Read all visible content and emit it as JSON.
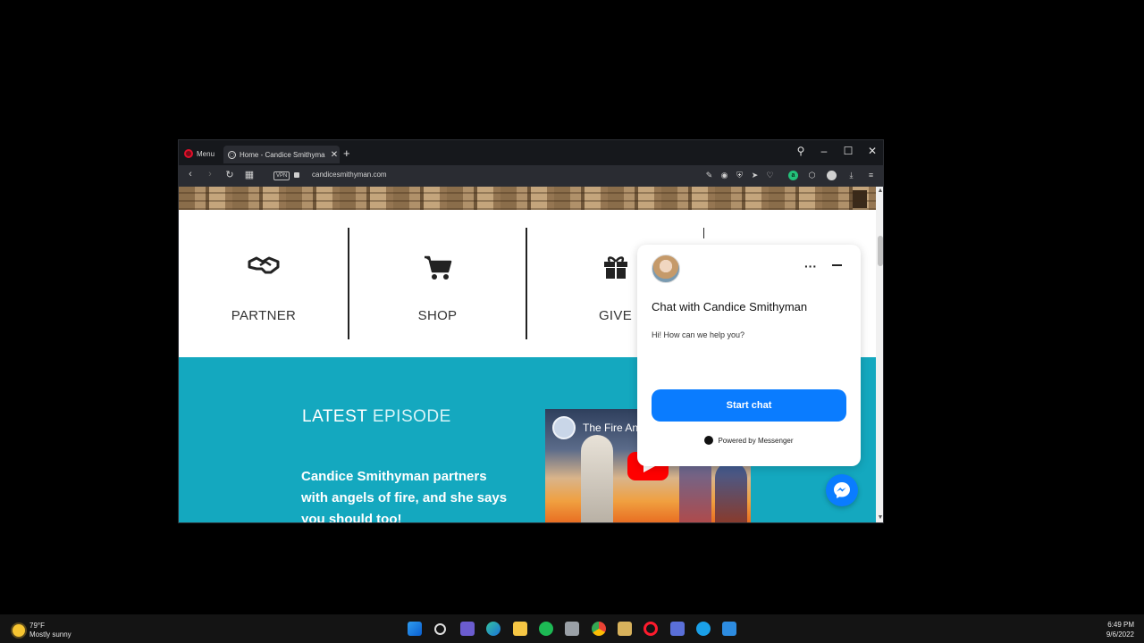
{
  "browser": {
    "menu_label": "Menu",
    "tab_title": "Home - Candice Smithyman",
    "url": "candicesmithyman.com",
    "vpn_label": "VPN"
  },
  "features": [
    {
      "label": "PARTNER",
      "icon": "handshake-icon"
    },
    {
      "label": "SHOP",
      "icon": "cart-icon"
    },
    {
      "label": "GIVE",
      "icon": "gift-icon"
    }
  ],
  "episode": {
    "heading_part1": "LATEST",
    "heading_part2": "EPISODE",
    "description": "Candice Smithyman partners with angels of fire, and she says you should too!",
    "video_title": "The Fire An"
  },
  "chat": {
    "title": "Chat with Candice Smithyman",
    "greeting": "Hi! How can we help you?",
    "start_button": "Start chat",
    "powered_by": "Powered by Messenger"
  },
  "taskbar": {
    "temperature": "79°F",
    "weather": "Mostly sunny",
    "time": "6:49 PM",
    "date": "9/6/2022"
  },
  "colors": {
    "episode_bg": "#14a8bf",
    "messenger_blue": "#0a7cff"
  }
}
